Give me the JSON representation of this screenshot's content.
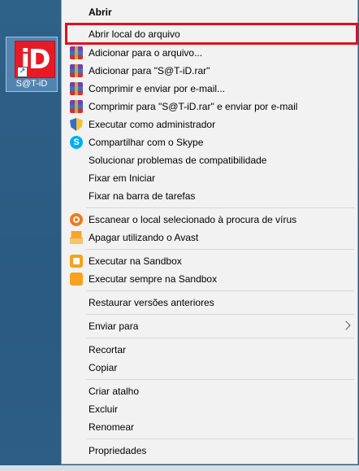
{
  "desktop": {
    "icon_label": "S@T-iD",
    "icon_glyph": "iD",
    "shortcut_glyph": "↗"
  },
  "context_menu": {
    "items": [
      {
        "label": "Abrir",
        "icon": null
      },
      {
        "label": "Abrir local do arquivo",
        "icon": null,
        "highlighted": true
      },
      {
        "label": "Adicionar para o arquivo...",
        "icon": "winrar-icon"
      },
      {
        "label": "Adicionar para \"S@T-iD.rar\"",
        "icon": "winrar-icon"
      },
      {
        "label": "Comprimir e enviar por e-mail...",
        "icon": "winrar-icon"
      },
      {
        "label": "Comprimir para \"S@T-iD.rar\" e enviar por e-mail",
        "icon": "winrar-icon"
      },
      {
        "label": "Executar como administrador",
        "icon": "uac-shield-icon"
      },
      {
        "label": "Compartilhar com o Skype",
        "icon": "skype-icon"
      },
      {
        "label": "Solucionar problemas de compatibilidade",
        "icon": null
      },
      {
        "label": "Fixar em Iniciar",
        "icon": null
      },
      {
        "label": "Fixar na barra de tarefas",
        "icon": null
      },
      {
        "label": "Escanear o local selecionado à procura de vírus",
        "icon": "avast-scan-icon"
      },
      {
        "label": "Apagar utilizando o Avast",
        "icon": "avast-shredder-icon"
      },
      {
        "label": "Executar na Sandbox",
        "icon": "sandbox-icon"
      },
      {
        "label": "Executar sempre na Sandbox",
        "icon": "sandbox-always-icon"
      },
      {
        "label": "Restaurar versões anteriores",
        "icon": null
      },
      {
        "label": "Enviar para",
        "icon": null,
        "submenu": true
      },
      {
        "label": "Recortar",
        "icon": null
      },
      {
        "label": "Copiar",
        "icon": null
      },
      {
        "label": "Criar atalho",
        "icon": null
      },
      {
        "label": "Excluir",
        "icon": null
      },
      {
        "label": "Renomear",
        "icon": null
      },
      {
        "label": "Propriedades",
        "icon": null
      }
    ],
    "skype_glyph": "S",
    "highlight_color": "#e0111b"
  },
  "colors": {
    "desktop": "#2d5f86",
    "menu_bg": "#f2f2f2"
  }
}
